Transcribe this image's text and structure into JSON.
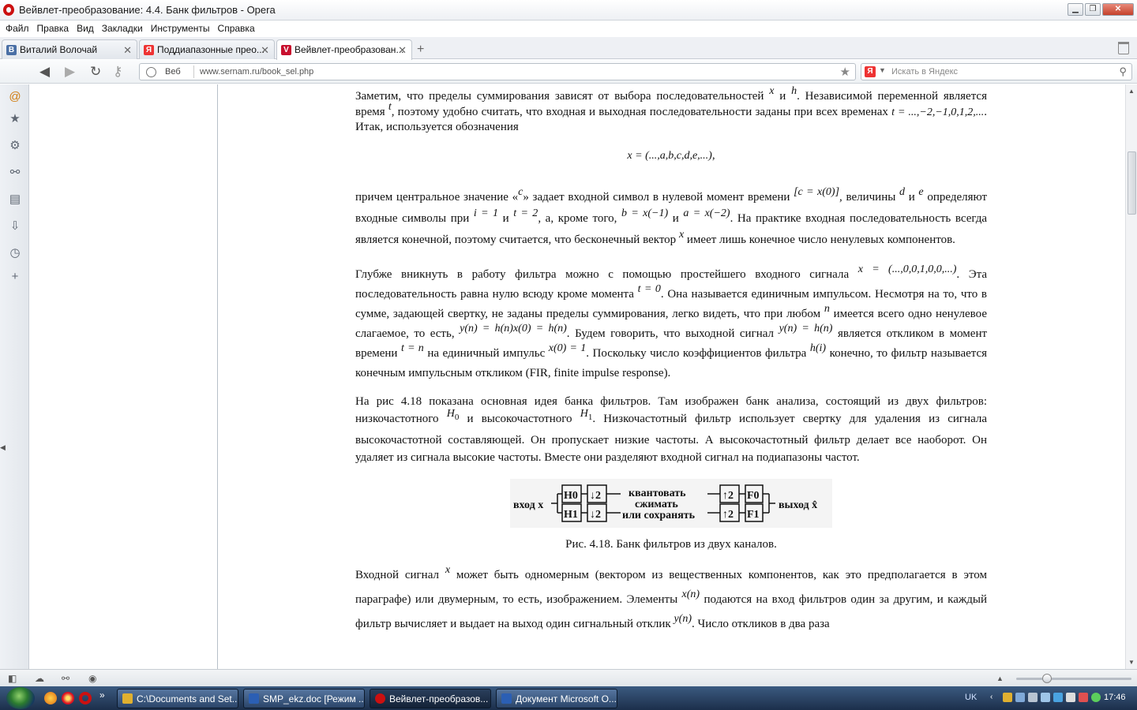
{
  "window": {
    "title": "Вейвлет-преобразование: 4.4. Банк фильтров - Opera",
    "controls": [
      "minimize",
      "maximize",
      "close"
    ]
  },
  "menu": [
    "Файл",
    "Правка",
    "Вид",
    "Закладки",
    "Инструменты",
    "Справка"
  ],
  "tabs": [
    {
      "label": "Виталий Волочай",
      "favicon": "В"
    },
    {
      "label": "Поддиапазонные прео...",
      "favicon": "Я"
    },
    {
      "label": "Вейвлет-преобразован...",
      "favicon": "V"
    }
  ],
  "nav": {
    "web_label": "Веб",
    "url": "www.sernam.ru/book_sel.php",
    "search_placeholder": "Искать в Яндекс",
    "search_engine": "Я"
  },
  "article": {
    "p1a": "Заметим, что пределы суммирования зависят от выбора последовательностей",
    "p1b": "и",
    "p1c": ". Независимой переменной является время",
    "p1d": ", поэтому удобно считать, что входная и выходная последовательности заданы при всех временах",
    "p1e": ". Итак, используется обозначения",
    "m_x": "x",
    "m_h": "h",
    "m_t": "t",
    "m_tvals": "t = ...,−2,−1,0,1,2,...",
    "eq1": "x = (...,a,b,c,d,e,...)",
    "eq1_tail": ",",
    "p2a": "причем центральное значение «",
    "m_c": "c",
    "p2b": "» задает входной символ в нулевой момент времени",
    "m_c0": "[c = x(0)]",
    "p2c": ", величины",
    "m_d": "d",
    "p2d": "и",
    "m_e": "e",
    "p2e": "определяют входные символы при",
    "m_i1": "i = 1",
    "p2f": "и",
    "m_t2": "t = 2",
    "p2g": ", а, кроме того,",
    "m_b": "b = x(−1)",
    "p2h": "и",
    "m_a": "a = x(−2)",
    "p2i": ". На практике входная последовательность всегда является конечной, поэтому считается, что бесконечный вектор",
    "p2j": "имеет лишь конечное число ненулевых компонентов.",
    "p3a": "Глубже вникнуть в работу фильтра можно с помощью простейшего входного сигнала",
    "m_imp": "x = (...,0,0,1,0,0,...)",
    "p3b": ". Эта последовательность равна нулю всюду кроме момента",
    "m_t0": "t = 0",
    "p3c": ". Она называется единичным импульсом. Несмотря на то, что в сумме, задающей свертку, не заданы пределы суммирования, легко видеть, что при любом",
    "m_n": "n",
    "p3d": "имеется всего одно ненулевое слагаемое, то есть,",
    "m_yn": "y(n) = h(n)x(0) = h(n)",
    "p3e": ". Будем говорить, что выходной сигнал",
    "m_yh": "y(n) = h(n)",
    "p3f": "является откликом в момент времени",
    "m_tn": "t = n",
    "p3g": "на единичный импульс",
    "m_x01": "x(0) = 1",
    "p3h": ". Поскольку число коэффициентов фильтра",
    "m_hi": "h(i)",
    "p3i": "конечно, то фильтр называется конечным импульсным откликом (FIR, finite impulse response).",
    "p4a": "На рис 4.18 показана основная идея банка фильтров. Там изображен банк анализа, состоящий из двух фильтров: низкочастотного",
    "m_H0": "H",
    "m_H0s": "0",
    "p4b": "и высокочастотного",
    "m_H1": "H",
    "m_H1s": "1",
    "p4c": ". Низкочастотный фильтр использует свертку для удаления из сигнала высокочастотной составляющей. Он пропускает низкие частоты. А высокочастотный фильтр делает все наоборот. Он удаляет из сигнала высокие частоты. Вместе они разделяют входной сигнал на подиапазоны частот.",
    "figure": {
      "input_label": "вход x",
      "h0": "H0",
      "h1": "H1",
      "down": "↓2",
      "up": "↑2",
      "mid_line1": "квантовать",
      "mid_line2": "сжимать",
      "mid_line3": "или сохранять",
      "f0": "F0",
      "f1": "F1",
      "output_label": "выход x̂"
    },
    "caption": "Рис. 4.18. Банк фильтров из двух каналов.",
    "p5a": "Входной сигнал",
    "p5b": "может быть одномерным (вектором из вещественных компонентов, как это предполагается в этом параграфе) или двумерным, то есть, изображением. Элементы",
    "m_xn": "x(n)",
    "p5c": "подаются на вход фильтров один за другим, и каждый фильтр вычисляет и выдает на выход один сигнальный отклик",
    "m_yn2": "y(n)",
    "p5d": ". Число откликов в два раза"
  },
  "taskbar": {
    "tasks": [
      {
        "label": "C:\\Documents and Set...",
        "icon_color": "#e0b030"
      },
      {
        "label": "SMP_ekz.doc [Режим ...",
        "icon_color": "#2b5fb4"
      },
      {
        "label": "Вейвлет-преобразов...",
        "icon_color": "#cc1010"
      },
      {
        "label": "Документ Microsoft O...",
        "icon_color": "#2b5fb4"
      }
    ],
    "lang": "UK",
    "clock": "17:46"
  },
  "colors": {
    "opera_red": "#cc1010",
    "taskbar": "#1c2f4b"
  }
}
